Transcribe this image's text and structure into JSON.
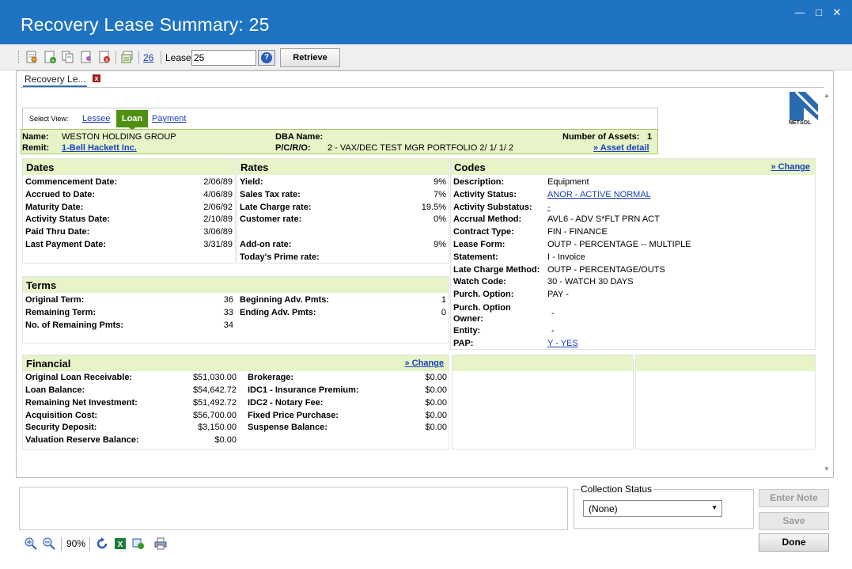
{
  "window": {
    "title": "Recovery Lease Summary: 25"
  },
  "toolbar": {
    "link_label": "26",
    "lease_label": "Lease",
    "lease_value": "25",
    "retrieve_label": "Retrieve",
    "help_glyph": "?"
  },
  "tab": {
    "label": "Recovery Le...",
    "close_glyph": "x"
  },
  "logo": {
    "text": "NETSOL"
  },
  "view": {
    "select_label": "Select View:",
    "lessee_label": "Lessee",
    "loan_label": "Loan",
    "payment_label": "Payment"
  },
  "info": {
    "name_label": "Name:",
    "name_value": "WESTON HOLDING GROUP",
    "remit_label": "Remit:",
    "remit_value": "1-Bell Hackett Inc.",
    "dba_label": "DBA Name:",
    "dba_value": "",
    "pcro_label": "P/C/R/O:",
    "pcro_value": "2 - VAX/DEC TEST MGR PORTFOLIO 2/ 1/ 1/ 2",
    "assets_label": "Number of Assets:",
    "assets_value": "1",
    "asset_detail_label": "» Asset detail"
  },
  "dates": {
    "title": "Dates",
    "rows": [
      {
        "label": "Commencement Date:",
        "value": "2/06/89"
      },
      {
        "label": "Accrued to Date:",
        "value": "4/06/89"
      },
      {
        "label": "Maturity Date:",
        "value": "2/06/92"
      },
      {
        "label": "Activity Status Date:",
        "value": "2/10/89"
      },
      {
        "label": "Paid Thru Date:",
        "value": "3/06/89"
      },
      {
        "label": "Last Payment Date:",
        "value": "3/31/89"
      }
    ]
  },
  "rates": {
    "title": "Rates",
    "rows": [
      {
        "label": "Yield:",
        "value": "9%"
      },
      {
        "label": "Sales Tax rate:",
        "value": "7%"
      },
      {
        "label": "Late Charge rate:",
        "value": "19.5%"
      },
      {
        "label": "Customer rate:",
        "value": "0%"
      },
      {
        "label": "Add-on rate:",
        "value": "9%"
      },
      {
        "label": "Today's Prime rate:",
        "value": ""
      }
    ]
  },
  "codes": {
    "title": "Codes",
    "change_label": "» Change",
    "rows": [
      {
        "label": "Description:",
        "value": "Equipment"
      },
      {
        "label": "Activity Status:",
        "value": "ANOR - ACTIVE NORMAL"
      },
      {
        "label": "Activity Substatus:",
        "value": " - "
      },
      {
        "label": "Accrual Method:",
        "value": "AVL6   -   ADV S*FLT PRN ACT"
      },
      {
        "label": "Contract Type:",
        "value": "FIN   -   FINANCE"
      },
      {
        "label": "Lease Form:",
        "value": "OUTP   -   PERCENTAGE -- MULTIPLE"
      },
      {
        "label": "Statement:",
        "value": "I   -   Invoice"
      },
      {
        "label": "Late Charge Method:",
        "value": "OUTP   -   PERCENTAGE/OUTS"
      },
      {
        "label": "Watch Code:",
        "value": "30   -   WATCH 30 DAYS"
      },
      {
        "label": "Purch. Option:",
        "value": "PAY   -"
      },
      {
        "label": "Purch. Option Owner:",
        "value": "-"
      },
      {
        "label": "Entity:",
        "value": "-"
      },
      {
        "label": "PAP:",
        "value": "Y - YES"
      }
    ]
  },
  "terms": {
    "title": "Terms",
    "left": [
      {
        "label": "Original Term:",
        "value": "36"
      },
      {
        "label": "Remaining Term:",
        "value": "33"
      },
      {
        "label": "No. of Remaining Pmts:",
        "value": "34"
      }
    ],
    "right": [
      {
        "label": "Beginning Adv. Pmts:",
        "value": "1"
      },
      {
        "label": "Ending Adv. Pmts:",
        "value": "0"
      }
    ]
  },
  "financial": {
    "title": "Financial",
    "change_label": "» Change",
    "left": [
      {
        "label": "Original Loan Receivable:",
        "value": "$51,030.00"
      },
      {
        "label": "Loan Balance:",
        "value": "$54,642.72"
      },
      {
        "label": "Remaining Net Investment:",
        "value": "$51,492.72"
      },
      {
        "label": "Acquisition Cost:",
        "value": "$56,700.00"
      },
      {
        "label": "Security Deposit:",
        "value": "$3,150.00"
      },
      {
        "label": "Valuation Reserve Balance:",
        "value": "$0.00"
      }
    ],
    "right": [
      {
        "label": "Brokerage:",
        "value": "$0.00"
      },
      {
        "label": "IDC1 - Insurance Premium:",
        "value": "$0.00"
      },
      {
        "label": "IDC2 - Notary Fee:",
        "value": "$0.00"
      },
      {
        "label": "Fixed Price Purchase:",
        "value": "$0.00"
      },
      {
        "label": "Suspense Balance:",
        "value": "$0.00"
      }
    ]
  },
  "bottom": {
    "collection_status_label": "Collection Status",
    "collection_status_value": "(None)",
    "enter_note_label": "Enter Note",
    "save_label": "Save",
    "done_label": "Done"
  },
  "status": {
    "zoom": "90%"
  }
}
